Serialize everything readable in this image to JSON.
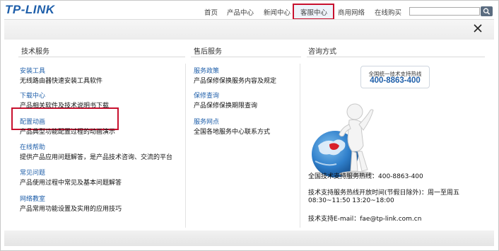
{
  "header": {
    "logo": "TP-LINK",
    "nav": [
      "首页",
      "产品中心",
      "新闻中心",
      "客服中心",
      "商用网络",
      "在线购买"
    ],
    "active": "客服中心"
  },
  "columns": {
    "tech": {
      "title": "技术服务",
      "items": [
        {
          "title": "安装工具",
          "desc": "无线路由器快速安装工具软件"
        },
        {
          "title": "下载中心",
          "desc": "产品相关软件及技术说明书下载"
        },
        {
          "title": "配置动画",
          "desc": "产品典型功能配置过程的动画演示"
        },
        {
          "title": "在线帮助",
          "desc": "提供产品应用问题解答，是产品技术咨询、交流的平台"
        },
        {
          "title": "常见问题",
          "desc": "产品使用过程中常见及基本问题解答"
        },
        {
          "title": "网络教室",
          "desc": "产品常用功能设置及实用的应用技巧"
        }
      ]
    },
    "after": {
      "title": "售后服务",
      "items": [
        {
          "title": "服务政策",
          "desc": "产品保修保换服务内容及规定"
        },
        {
          "title": "保修查询",
          "desc": "产品保修保换期限查询"
        },
        {
          "title": "服务网点",
          "desc": "全国各地服务中心联系方式"
        }
      ]
    },
    "contact": {
      "title": "咨询方式",
      "badge_top": "全国统一技术支持热线",
      "badge_number": "400-8863-400",
      "hotline": "全国技术支持服务热线：400-8863-400",
      "hours1": "技术支持服务热线开放时间(节假日除外)：周一至周五",
      "hours2": "08:30~11:50 13:20~18:00",
      "email": "技术支持E-mail：fae@tp-link.com.cn"
    }
  },
  "colors": {
    "link": "#1f5faa",
    "highlight": "#c8102e"
  }
}
